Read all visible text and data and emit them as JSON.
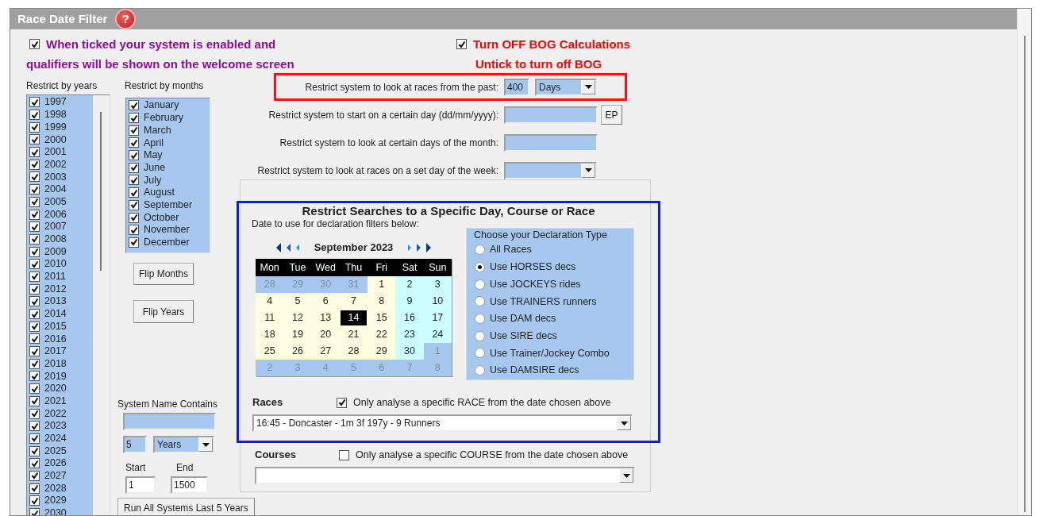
{
  "form_title": "Race Date Filter",
  "help_icon": "?",
  "system_enabled": {
    "checked": true,
    "line_1": "When ticked your system is enabled and",
    "line_2": "qualifiers will be shown on the welcome screen"
  },
  "bog": {
    "checked": true,
    "label": "Turn OFF BOG Calculations",
    "note": "Untick to turn off BOG"
  },
  "years": {
    "label": "Restrict by years",
    "items": [
      {
        "label": "1997",
        "checked": true
      },
      {
        "label": "1998",
        "checked": true
      },
      {
        "label": "1999",
        "checked": true
      },
      {
        "label": "2000",
        "checked": true
      },
      {
        "label": "2001",
        "checked": true
      },
      {
        "label": "2002",
        "checked": true
      },
      {
        "label": "2003",
        "checked": true
      },
      {
        "label": "2004",
        "checked": true
      },
      {
        "label": "2005",
        "checked": true
      },
      {
        "label": "2006",
        "checked": true
      },
      {
        "label": "2007",
        "checked": true
      },
      {
        "label": "2008",
        "checked": true
      },
      {
        "label": "2009",
        "checked": true
      },
      {
        "label": "2010",
        "checked": true
      },
      {
        "label": "2011",
        "checked": true
      },
      {
        "label": "2012",
        "checked": true
      },
      {
        "label": "2013",
        "checked": true
      },
      {
        "label": "2014",
        "checked": true
      },
      {
        "label": "2015",
        "checked": true
      },
      {
        "label": "2016",
        "checked": true
      },
      {
        "label": "2017",
        "checked": true
      },
      {
        "label": "2018",
        "checked": true
      },
      {
        "label": "2019",
        "checked": true
      },
      {
        "label": "2020",
        "checked": true
      },
      {
        "label": "2021",
        "checked": true
      },
      {
        "label": "2022",
        "checked": true
      },
      {
        "label": "2023",
        "checked": true
      },
      {
        "label": "2024",
        "checked": true
      },
      {
        "label": "2025",
        "checked": true
      },
      {
        "label": "2026",
        "checked": true
      },
      {
        "label": "2027",
        "checked": true
      },
      {
        "label": "2028",
        "checked": true
      },
      {
        "label": "2029",
        "checked": true
      },
      {
        "label": "2030",
        "checked": true
      }
    ]
  },
  "months": {
    "label": "Restrict by months",
    "items": [
      {
        "label": "January",
        "checked": true
      },
      {
        "label": "February",
        "checked": true
      },
      {
        "label": "March",
        "checked": true
      },
      {
        "label": "April",
        "checked": true
      },
      {
        "label": "May",
        "checked": true
      },
      {
        "label": "June",
        "checked": true
      },
      {
        "label": "July",
        "checked": true
      },
      {
        "label": "August",
        "checked": true
      },
      {
        "label": "September",
        "checked": true
      },
      {
        "label": "October",
        "checked": true
      },
      {
        "label": "November",
        "checked": true
      },
      {
        "label": "December",
        "checked": true
      }
    ]
  },
  "flip_buttons": [
    "Flip Months",
    "Flip Years"
  ],
  "system_name": {
    "label": "System Name Contains"
  },
  "period": {
    "value": "5",
    "unit": "Years"
  },
  "range": {
    "start_label": "Start",
    "start_value": "1",
    "end_label": "End",
    "end_value": "1500"
  },
  "run_button": "Run All Systems Last 5 Years",
  "restrictions": [
    {
      "kind": "number_unit",
      "label": "Restrict system to look at races from the past:",
      "value": "400",
      "unit": "Days",
      "highlighted": true
    },
    {
      "kind": "date",
      "label": "Restrict system to start on a certain day (dd/mm/yyyy):",
      "button": "EP",
      "highlighted": false
    },
    {
      "kind": "text",
      "label": "Restrict system to look at certain days of the month:",
      "highlighted": false
    },
    {
      "kind": "dropdown",
      "label": "Restrict system to look at races on a set day of the week:",
      "highlighted": false
    }
  ],
  "specific_search": {
    "title": "Restrict Searches to a Specific Day, Course or Race",
    "highlighted": true,
    "date_label": "Date to use for declaration filters below:",
    "calendar": {
      "month": "September 2023",
      "weekdays": [
        "Mon",
        "Tue",
        "Wed",
        "Thu",
        "Fri",
        "Sat",
        "Sun"
      ],
      "days": [
        {
          "day": "28",
          "kind": "other",
          "selected": false
        },
        {
          "day": "29",
          "kind": "other",
          "selected": false
        },
        {
          "day": "30",
          "kind": "other",
          "selected": false
        },
        {
          "day": "31",
          "kind": "other",
          "selected": false
        },
        {
          "day": "1",
          "kind": "weekday",
          "selected": false
        },
        {
          "day": "2",
          "kind": "weekend",
          "selected": false
        },
        {
          "day": "3",
          "kind": "weekend",
          "selected": false
        },
        {
          "day": "4",
          "kind": "weekday",
          "selected": false
        },
        {
          "day": "5",
          "kind": "weekday",
          "selected": false
        },
        {
          "day": "6",
          "kind": "weekday",
          "selected": false
        },
        {
          "day": "7",
          "kind": "weekday",
          "selected": false
        },
        {
          "day": "8",
          "kind": "weekday",
          "selected": false
        },
        {
          "day": "9",
          "kind": "weekend",
          "selected": false
        },
        {
          "day": "10",
          "kind": "weekend",
          "selected": false
        },
        {
          "day": "11",
          "kind": "weekday",
          "selected": false
        },
        {
          "day": "12",
          "kind": "weekday",
          "selected": false
        },
        {
          "day": "13",
          "kind": "weekday",
          "selected": false
        },
        {
          "day": "14",
          "kind": "weekday",
          "selected": true
        },
        {
          "day": "15",
          "kind": "weekday",
          "selected": false
        },
        {
          "day": "16",
          "kind": "weekend",
          "selected": false
        },
        {
          "day": "17",
          "kind": "weekend",
          "selected": false
        },
        {
          "day": "18",
          "kind": "weekday",
          "selected": false
        },
        {
          "day": "19",
          "kind": "weekday",
          "selected": false
        },
        {
          "day": "20",
          "kind": "weekday",
          "selected": false
        },
        {
          "day": "21",
          "kind": "weekday",
          "selected": false
        },
        {
          "day": "22",
          "kind": "weekday",
          "selected": false
        },
        {
          "day": "23",
          "kind": "weekend",
          "selected": false
        },
        {
          "day": "24",
          "kind": "weekend",
          "selected": false
        },
        {
          "day": "25",
          "kind": "weekday",
          "selected": false
        },
        {
          "day": "26",
          "kind": "weekday",
          "selected": false
        },
        {
          "day": "27",
          "kind": "weekday",
          "selected": false
        },
        {
          "day": "28",
          "kind": "weekday",
          "selected": false
        },
        {
          "day": "29",
          "kind": "weekday",
          "selected": false
        },
        {
          "day": "30",
          "kind": "weekend",
          "selected": false
        },
        {
          "day": "1",
          "kind": "other",
          "selected": false
        },
        {
          "day": "2",
          "kind": "other",
          "selected": false
        },
        {
          "day": "3",
          "kind": "other",
          "selected": false
        },
        {
          "day": "4",
          "kind": "other",
          "selected": false
        },
        {
          "day": "5",
          "kind": "other",
          "selected": false
        },
        {
          "day": "6",
          "kind": "other",
          "selected": false
        },
        {
          "day": "7",
          "kind": "other",
          "selected": false
        },
        {
          "day": "8",
          "kind": "other",
          "selected": false
        }
      ]
    },
    "declaration": {
      "legend": "Choose your Declaration Type",
      "options": [
        {
          "label": "All Races",
          "selected": false
        },
        {
          "label": "Use HORSES decs",
          "selected": true
        },
        {
          "label": "Use JOCKEYS rides",
          "selected": false
        },
        {
          "label": "Use TRAINERS runners",
          "selected": false
        },
        {
          "label": "Use DAM decs",
          "selected": false
        },
        {
          "label": "Use SIRE decs",
          "selected": false
        },
        {
          "label": "Use Trainer/Jockey Combo",
          "selected": false
        },
        {
          "label": "Use DAMSIRE decs",
          "selected": false
        }
      ]
    },
    "races": {
      "label": "Races",
      "checked": true,
      "check_label": "Only analyse a specific RACE from the date chosen above",
      "value": "16:45 - Doncaster - 1m 3f 197y - 9 Runners"
    }
  },
  "courses": {
    "label": "Courses",
    "checked": false,
    "check_label": "Only analyse a specific COURSE from the date chosen above"
  }
}
